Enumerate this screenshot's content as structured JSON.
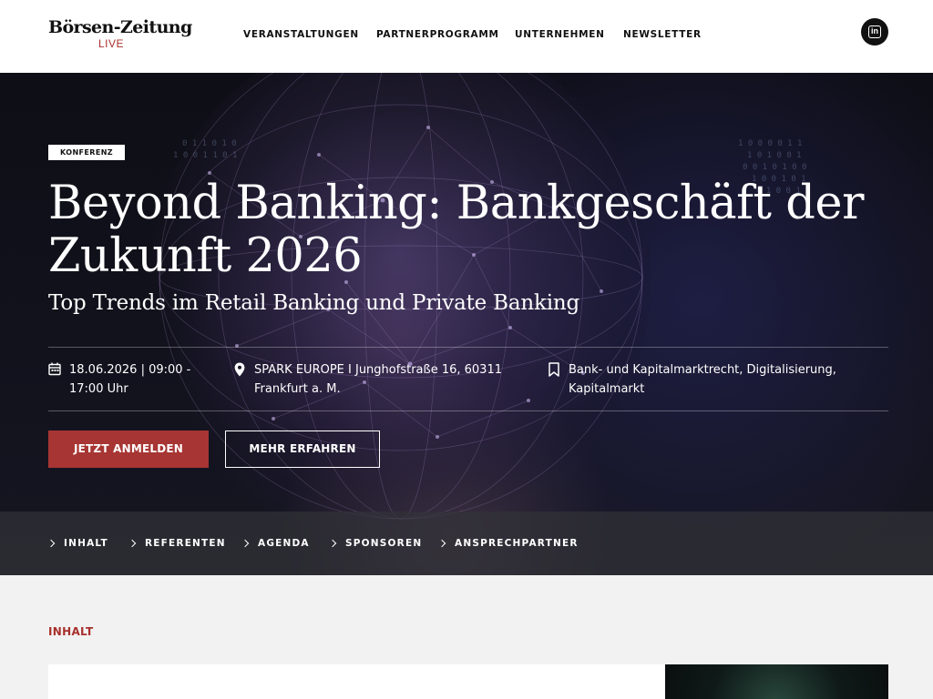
{
  "header": {
    "logo_main": "Börsen-Zeitung",
    "logo_sub": "LIVE",
    "nav": [
      "VERANSTALTUNGEN",
      "PARTNERPROGRAMM",
      "UNTERNEHMEN",
      "NEWSLETTER"
    ],
    "social_icon": "linkedin-icon",
    "social_letters": "in"
  },
  "hero": {
    "tag": "KONFERENZ",
    "title": "Beyond Banking: Bankgeschäft der Zukunft 2026",
    "subtitle": "Top Trends im Retail Banking und Private Banking",
    "date": "18.06.2026 | 09:00 - 17:00 Uhr",
    "location": "SPARK EUROPE I Junghofstraße 16, 60311 Frankfurt a. M.",
    "topics": "Bank- und Kapitalmarktrecht, Digitalisierung, Kapitalmarkt",
    "primary_button": "JETZT ANMELDEN",
    "secondary_button": "MEHR ERFAHREN",
    "icons": [
      "calendar-icon",
      "location-pin-icon",
      "bookmark-icon"
    ]
  },
  "subnav": [
    "INHALT",
    "REFERENTEN",
    "AGENDA",
    "SPONSOREN",
    "ANSPRECHPARTNER"
  ],
  "content": {
    "section_label": "INHALT"
  },
  "colors": {
    "accent": "#a73533",
    "hero_bg": "#12121d",
    "content_bg": "#f2f2f2"
  }
}
